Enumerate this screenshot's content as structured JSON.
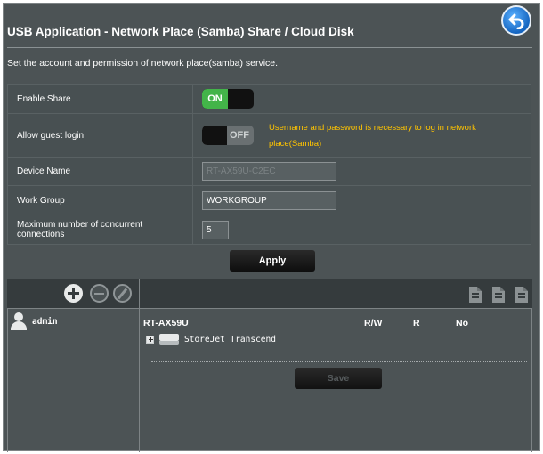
{
  "header": {
    "title": "USB Application - Network Place (Samba) Share / Cloud Disk",
    "description": "Set the account and permission of network place(samba) service."
  },
  "form": {
    "enable_share": {
      "label": "Enable Share",
      "toggle": "ON"
    },
    "allow_guest": {
      "label": "Allow guest login",
      "toggle": "OFF",
      "warning": "Username and password is necessary to log in network place(Samba)"
    },
    "device_name": {
      "label": "Device Name",
      "value": "RT-AX59U-C2EC"
    },
    "work_group": {
      "label": "Work Group",
      "value": "WORKGROUP"
    },
    "max_conn": {
      "label": "Maximum number of concurrent connections",
      "value": "5"
    },
    "apply_label": "Apply"
  },
  "accounts": {
    "users": [
      {
        "name": "admin"
      }
    ]
  },
  "shares": {
    "device": "RT-AX59U",
    "columns": [
      "R/W",
      "R",
      "No"
    ],
    "items": [
      {
        "name": "StoreJet Transcend"
      }
    ],
    "save_label": "Save"
  },
  "colors": {
    "panel_bg": "#4c5355",
    "toggle_on": "#43b449",
    "warning_text": "#ffc400",
    "back_button": "#1e88e5"
  }
}
